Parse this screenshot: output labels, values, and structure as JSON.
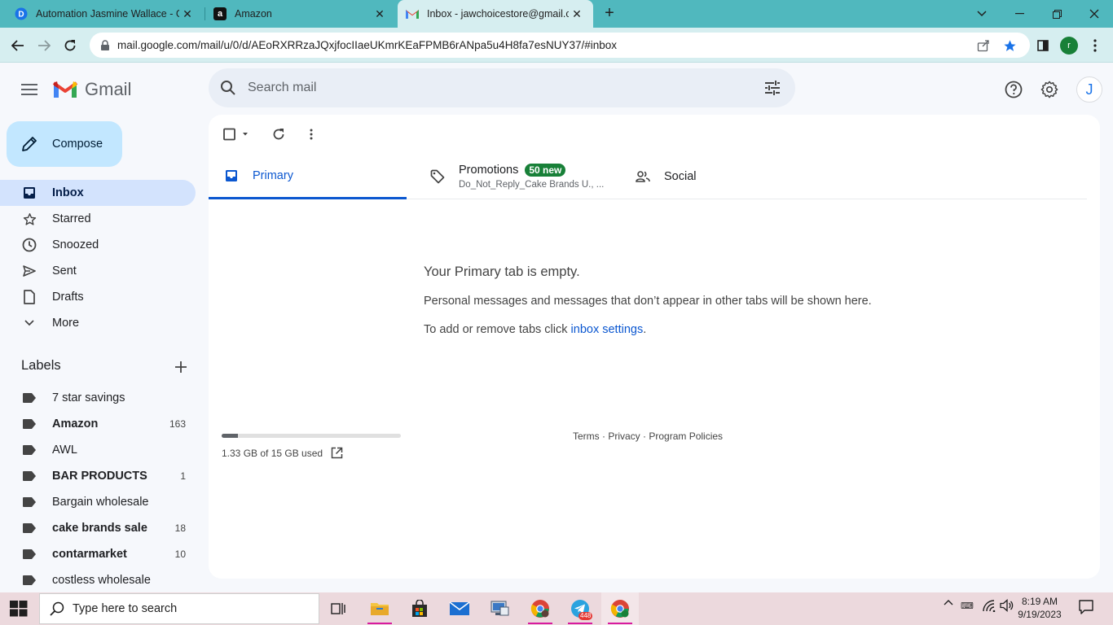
{
  "browser": {
    "tabs": [
      {
        "title": "Automation Jasmine Wallace - Go",
        "favicon": "drive-favicon-icon",
        "active": false
      },
      {
        "title": "Amazon",
        "favicon": "amazon-favicon-icon",
        "active": false
      },
      {
        "title": "Inbox - jawchoicestore@gmail.co",
        "favicon": "gmail-favicon-icon",
        "active": true
      }
    ],
    "url": "mail.google.com/mail/u/0/d/AEoRXRRzaJQxjfocIIaeUKmrKEaFPMB6rANpa5u4H8fa7esNUY37/#inbox",
    "profile_initial": "r"
  },
  "gmail": {
    "brand": "Gmail",
    "search_placeholder": "Search mail",
    "avatar_initial": "J",
    "compose_label": "Compose",
    "nav": [
      {
        "label": "Inbox",
        "icon": "inbox-icon",
        "active": true
      },
      {
        "label": "Starred",
        "icon": "star-icon",
        "active": false
      },
      {
        "label": "Snoozed",
        "icon": "clock-icon",
        "active": false
      },
      {
        "label": "Sent",
        "icon": "send-icon",
        "active": false
      },
      {
        "label": "Drafts",
        "icon": "draft-icon",
        "active": false
      },
      {
        "label": "More",
        "icon": "chevron-down-icon",
        "active": false
      }
    ],
    "labels_title": "Labels",
    "labels": [
      {
        "name": "7 star savings",
        "count": "",
        "bold": false
      },
      {
        "name": "Amazon",
        "count": "163",
        "bold": true
      },
      {
        "name": "AWL",
        "count": "",
        "bold": false
      },
      {
        "name": "BAR PRODUCTS",
        "count": "1",
        "bold": true
      },
      {
        "name": "Bargain wholesale",
        "count": "",
        "bold": false
      },
      {
        "name": "cake brands sale",
        "count": "18",
        "bold": true
      },
      {
        "name": "contarmarket",
        "count": "10",
        "bold": true
      },
      {
        "name": "costless wholesale",
        "count": "",
        "bold": false
      }
    ],
    "tabs": {
      "primary": "Primary",
      "promotions": "Promotions",
      "promotions_badge": "50 new",
      "promotions_sub": "Do_Not_Reply_Cake Brands U., ...",
      "social": "Social"
    },
    "empty": {
      "title": "Your Primary tab is empty.",
      "message": "Personal messages and messages that don’t appear in other tabs will be shown here.",
      "hint_prefix": "To add or remove tabs click ",
      "hint_link": "inbox settings",
      "hint_suffix": "."
    },
    "storage": {
      "text": "1.33 GB of 15 GB used",
      "fraction": 0.089
    },
    "footer": {
      "terms": "Terms",
      "privacy": "Privacy",
      "policies": "Program Policies",
      "separator": " · "
    }
  },
  "taskbar": {
    "search_placeholder": "Type here to search",
    "telegram_badge": "448",
    "time": "8:19 AM",
    "date": "9/19/2023"
  },
  "colors": {
    "tabstrip": "#50b8be",
    "accent_blue": "#0b57d0",
    "compose_bg": "#c2e7ff",
    "active_nav": "#d3e3fd",
    "badge_green": "#188038"
  }
}
